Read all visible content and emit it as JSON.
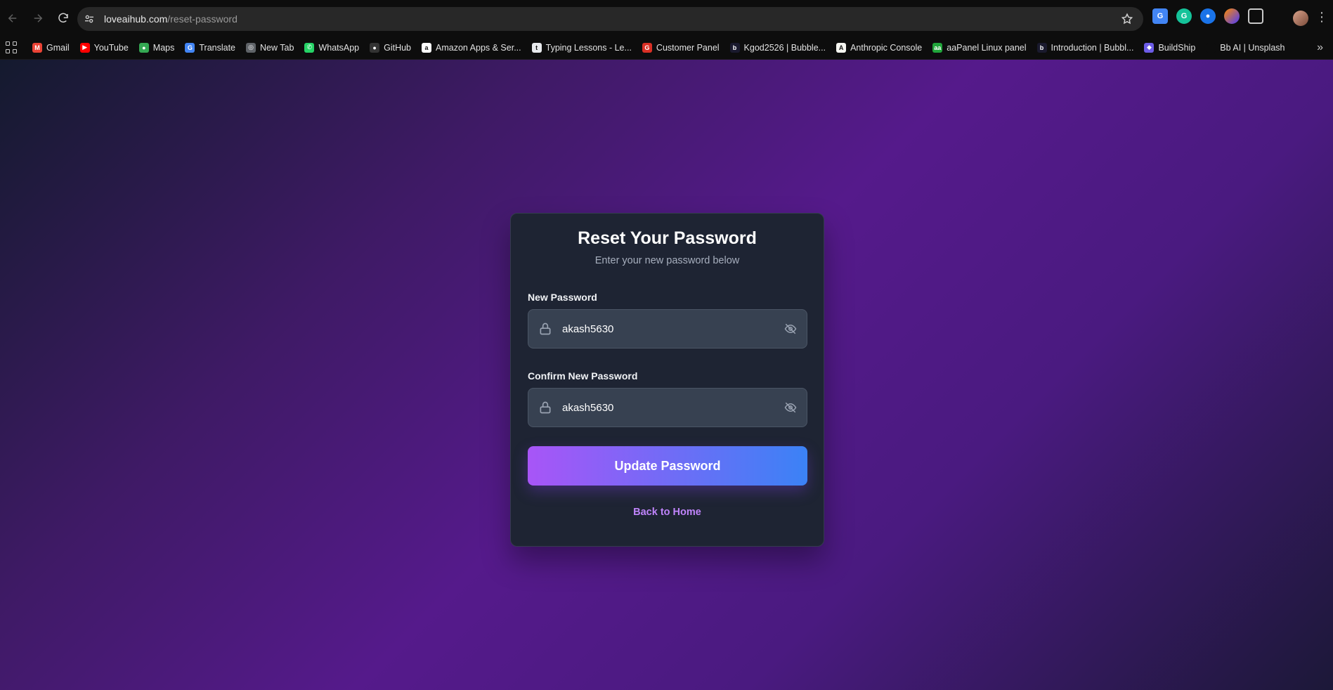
{
  "browser": {
    "url_host": "loveaihub.com",
    "url_path": "/reset-password"
  },
  "bookmarks": [
    {
      "label": "Gmail",
      "icon": "gmail-icon",
      "color": "#ea4335",
      "glyph": "M"
    },
    {
      "label": "YouTube",
      "icon": "youtube-icon",
      "color": "#ff0000",
      "glyph": "▶"
    },
    {
      "label": "Maps",
      "icon": "maps-icon",
      "color": "#34a853",
      "glyph": "●"
    },
    {
      "label": "Translate",
      "icon": "translate-icon",
      "color": "#4285f4",
      "glyph": "G"
    },
    {
      "label": "New Tab",
      "icon": "globe-icon",
      "color": "#5f6368",
      "glyph": "◎"
    },
    {
      "label": "WhatsApp",
      "icon": "whatsapp-icon",
      "color": "#25d366",
      "glyph": "✆"
    },
    {
      "label": "GitHub",
      "icon": "github-icon",
      "color": "#333333",
      "glyph": "●"
    },
    {
      "label": "Amazon Apps & Ser...",
      "icon": "amazon-icon",
      "color": "#ffffff",
      "glyph": "a"
    },
    {
      "label": "Typing Lessons - Le...",
      "icon": "typing-icon",
      "color": "#e8eaed",
      "glyph": "t"
    },
    {
      "label": "Customer Panel",
      "icon": "customer-panel-icon",
      "color": "#d93025",
      "glyph": "G"
    },
    {
      "label": "Kgod2526 | Bubble...",
      "icon": "bubble-icon",
      "color": "#1a1a2e",
      "glyph": "b"
    },
    {
      "label": "Anthropic Console",
      "icon": "anthropic-icon",
      "color": "#f5f5f0",
      "glyph": "A"
    },
    {
      "label": "aaPanel Linux panel",
      "icon": "aapanel-icon",
      "color": "#20a53a",
      "glyph": "aa"
    },
    {
      "label": "Introduction | Bubbl...",
      "icon": "bubble-icon",
      "color": "#1a1a2e",
      "glyph": "b"
    },
    {
      "label": "BuildShip",
      "icon": "buildship-icon",
      "color": "#6c5ce7",
      "glyph": "◆"
    },
    {
      "label": "Bb AI | Unsplash",
      "icon": "unsplash-icon",
      "color": "#0d0d0d",
      "glyph": ""
    }
  ],
  "card": {
    "title": "Reset Your Password",
    "subtitle": "Enter your new password below",
    "new_password_label": "New Password",
    "new_password_value": "akash5630",
    "confirm_password_label": "Confirm New Password",
    "confirm_password_value": "akash5630",
    "submit_label": "Update Password",
    "back_link": "Back to Home"
  },
  "colors": {
    "button_gradient_start": "#a855f7",
    "button_gradient_end": "#3b82f6",
    "link": "#c084fc",
    "card_bg": "#1e2433"
  }
}
